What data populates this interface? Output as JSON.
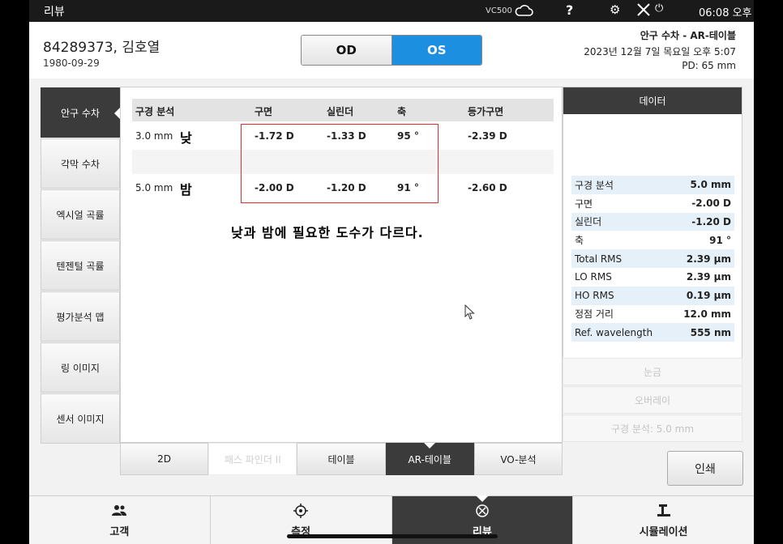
{
  "statusbar": {
    "title": "리뷰",
    "device": "VC500",
    "help": "?",
    "gear": "⚙",
    "power": "⏻",
    "time": "06:08 오후"
  },
  "patient": {
    "name": "84289373, 김호열",
    "dob": "1980-09-29"
  },
  "eye_toggle": {
    "od": "OD",
    "os": "OS",
    "selected": "OS"
  },
  "header_info": {
    "mode": "안구 수차 - AR-테이블",
    "datetime": "2023년 12월 7일 목요일 오후 5:07",
    "pd": "PD: 65 mm"
  },
  "left_nav": [
    {
      "label": "안구 수차",
      "active": true
    },
    {
      "label": "각막 수차",
      "active": false
    },
    {
      "label": "엑시얼 곡률",
      "active": false
    },
    {
      "label": "텐젠털 곡률",
      "active": false
    },
    {
      "label": "평가분석 맵",
      "active": false
    },
    {
      "label": "링 이미지",
      "active": false
    },
    {
      "label": "센서 이미지",
      "active": false
    }
  ],
  "table": {
    "headers": [
      "구경 분석",
      "구면",
      "실린더",
      "축",
      "등가구면"
    ],
    "rows": [
      {
        "aperture": "3.0 mm",
        "tag": "낮",
        "sphere": "-1.72 D",
        "cylinder": "-1.33 D",
        "axis": "95 °",
        "se": "-2.39 D"
      },
      {
        "aperture": "5.0 mm",
        "tag": "밤",
        "sphere": "-2.00 D",
        "cylinder": "-1.20 D",
        "axis": "91 °",
        "se": "-2.60 D"
      }
    ],
    "annotation": "낮과 밤에 필요한 도수가 다르다."
  },
  "right_panel": {
    "title": "데이터",
    "rows": [
      {
        "label": "구경 분석",
        "value": "5.0 mm"
      },
      {
        "label": "구면",
        "value": "-2.00 D"
      },
      {
        "label": "실린더",
        "value": "-1.20 D"
      },
      {
        "label": "축",
        "value": "91 °"
      },
      {
        "label": "Total RMS",
        "value": "2.39 µm"
      },
      {
        "label": "LO RMS",
        "value": "2.39 µm"
      },
      {
        "label": "HO RMS",
        "value": "0.19 µm"
      },
      {
        "label": "정점 거리",
        "value": "12.0 mm"
      },
      {
        "label": "Ref. wavelength",
        "value": "555 nm"
      }
    ],
    "disabled_buttons": [
      "눈금",
      "오버레이",
      "구경 분석: 5.0 mm"
    ]
  },
  "bottom_tabs": [
    {
      "label": "2D",
      "state": "normal"
    },
    {
      "label": "패스 파인더 II",
      "state": "disabled"
    },
    {
      "label": "테이블",
      "state": "normal"
    },
    {
      "label": "AR-테이블",
      "state": "active"
    },
    {
      "label": "VO-분석",
      "state": "normal"
    }
  ],
  "print_label": "인쇄",
  "app_bar": [
    {
      "label": "고객",
      "icon": "people-icon",
      "active": false
    },
    {
      "label": "측정",
      "icon": "measure-icon",
      "active": false
    },
    {
      "label": "리뷰",
      "icon": "review-icon",
      "active": true
    },
    {
      "label": "시뮬레이션",
      "icon": "simulation-icon",
      "active": false
    }
  ],
  "colors": {
    "accent": "#1c8fe0",
    "dark": "#3b3b3b",
    "highlight_box": "#e03030"
  }
}
